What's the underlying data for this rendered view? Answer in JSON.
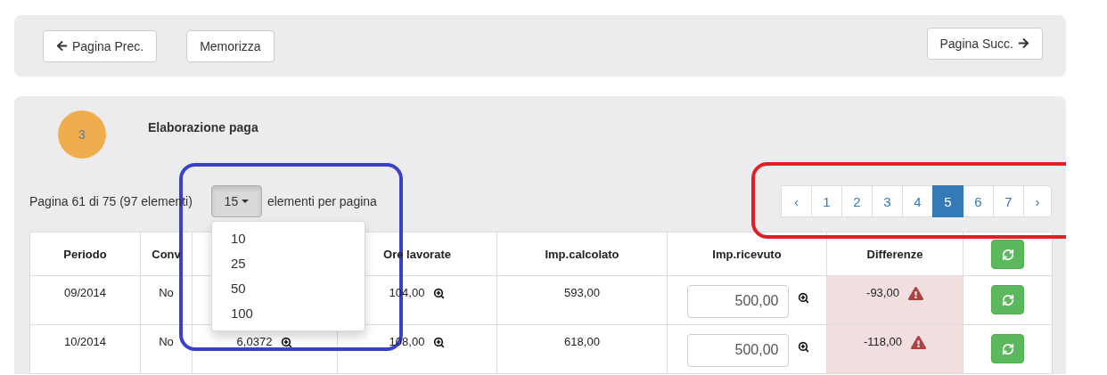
{
  "toolbar": {
    "buttons": [
      {
        "kind": "prev",
        "label": "Pagina Prec."
      },
      {
        "kind": "save",
        "label": "Memorizza"
      },
      {
        "kind": "next",
        "label": "Pagina Succ."
      }
    ]
  },
  "section": {
    "step": "3",
    "title": "Elaborazione paga"
  },
  "pager": {
    "summary": "Pagina 61 di 75 (97 elementi)",
    "page_size": "15",
    "page_size_suffix": "elementi per pagina",
    "page_size_menu": {
      "expanded": true,
      "options": [
        "10",
        "25",
        "50",
        "100"
      ]
    }
  },
  "pagination": {
    "prev": "‹",
    "next": "›",
    "pages": [
      {
        "label": "1",
        "selected": false
      },
      {
        "label": "2",
        "selected": false
      },
      {
        "label": "3",
        "selected": false
      },
      {
        "label": "4",
        "selected": false
      },
      {
        "label": "5",
        "selected": true
      },
      {
        "label": "6",
        "selected": false
      },
      {
        "label": "7",
        "selected": false
      }
    ]
  },
  "table": {
    "columns": [
      {
        "kind": "text",
        "label": "Periodo"
      },
      {
        "kind": "text",
        "label": "Conv"
      },
      {
        "kind": "covered"
      },
      {
        "kind": "text",
        "label": "Ore lavorate"
      },
      {
        "kind": "text",
        "label": "Imp.calcolato"
      },
      {
        "kind": "text",
        "label": "Imp.ricevuto"
      },
      {
        "kind": "text",
        "label": "Differenze"
      },
      {
        "kind": "button"
      }
    ],
    "rows": [
      {
        "cells": [
          {
            "kind": "text",
            "text": "09/2014",
            "zoom": false
          },
          {
            "kind": "text",
            "text": "No",
            "zoom": false
          },
          {
            "kind": "covered"
          },
          {
            "kind": "text",
            "text": "104,00",
            "zoom": true
          },
          {
            "kind": "text",
            "text": "593,00",
            "zoom": false
          },
          {
            "kind": "input",
            "value": "500,00",
            "zoom": true
          },
          {
            "kind": "diff",
            "text": "-93,00",
            "warning": true
          },
          {
            "kind": "button"
          }
        ]
      },
      {
        "cells": [
          {
            "kind": "text",
            "text": "10/2014",
            "zoom": false
          },
          {
            "kind": "text",
            "text": "No",
            "zoom": false
          },
          {
            "kind": "text",
            "text": "6,0372",
            "zoom": true
          },
          {
            "kind": "text",
            "text": "108,00",
            "zoom": true
          },
          {
            "kind": "text",
            "text": "618,00",
            "zoom": false
          },
          {
            "kind": "input",
            "value": "500,00",
            "zoom": true
          },
          {
            "kind": "diff",
            "text": "-118,00",
            "warning": true
          },
          {
            "kind": "button"
          }
        ]
      }
    ]
  },
  "annotations": [
    {
      "kind": "page_size",
      "color": "#3b40c8"
    },
    {
      "kind": "pagination",
      "color": "#e01f26"
    }
  ]
}
